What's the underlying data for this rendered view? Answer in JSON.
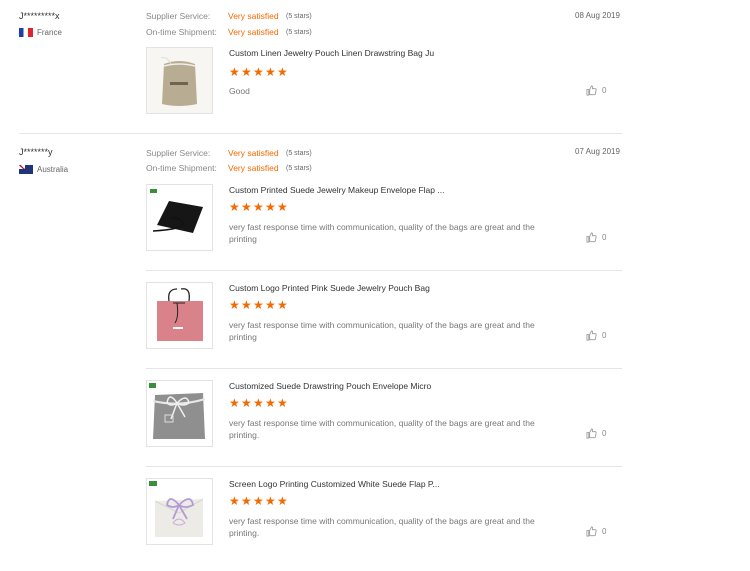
{
  "reviews": [
    {
      "buyer": "J*********x",
      "country": "France",
      "supplier_label": "Supplier Service:",
      "supplier_value": "Very satisfied",
      "supplier_stars": "(5 stars)",
      "shipment_label": "On-time Shipment:",
      "shipment_value": "Very satisfied",
      "shipment_stars": "(5 stars)",
      "date": "08 Aug 2019",
      "products": [
        {
          "title": "Custom Linen Jewelry Pouch Linen Drawstring Bag Ju",
          "rating": 5,
          "comment": "Good",
          "likes": "0"
        }
      ]
    },
    {
      "buyer": "J*******y",
      "country": "Australia",
      "supplier_label": "Supplier Service:",
      "supplier_value": "Very satisfied",
      "supplier_stars": "(5 stars)",
      "shipment_label": "On-time Shipment:",
      "shipment_value": "Very satisfied",
      "shipment_stars": "(5 stars)",
      "date": "07 Aug 2019",
      "products": [
        {
          "title": "Custom Printed Suede Jewelry Makeup Envelope Flap ...",
          "rating": 5,
          "comment": "very fast response time with communication, quality of the bags are great and the printing",
          "likes": "0"
        },
        {
          "title": "Custom Logo Printed Pink Suede Jewelry Pouch Bag",
          "rating": 5,
          "comment": "very fast response time with communication, quality of the bags are great and the printing",
          "likes": "0"
        },
        {
          "title": "Customized Suede Drawstring Pouch Envelope Micro",
          "rating": 5,
          "comment": "very fast response time with communication, quality of the bags are great and the printing.",
          "likes": "0"
        },
        {
          "title": "Screen Logo Printing Customized White Suede Flap P...",
          "rating": 5,
          "comment": "very fast response time with communication, quality of the bags are great and the printing.",
          "likes": "0"
        }
      ]
    }
  ],
  "colors": {
    "accent": "#f26a00",
    "divider": "#e6e6e6"
  },
  "icons": {
    "like": "thumbs-up-icon",
    "star": "star-icon"
  }
}
